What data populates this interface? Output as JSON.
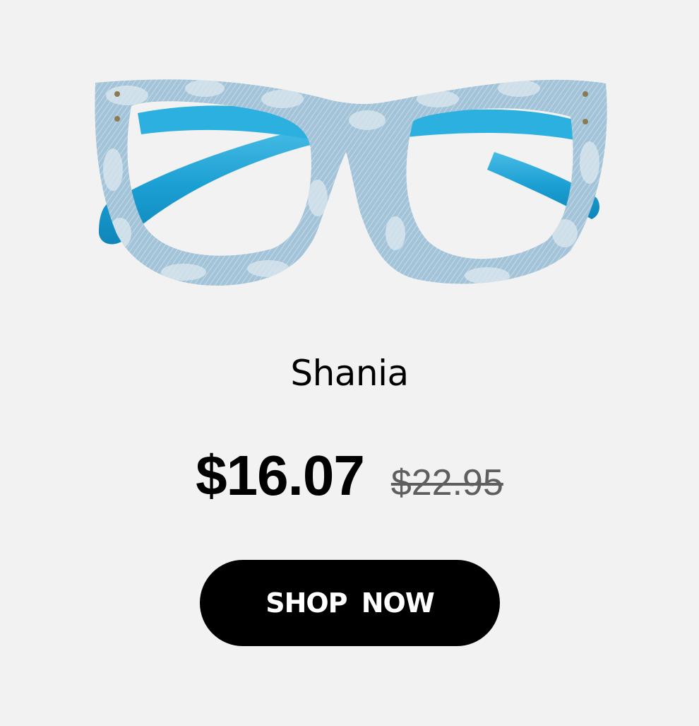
{
  "product": {
    "image_icon": "eyeglasses-icon",
    "name": "Shania",
    "price_current": "$16.07",
    "price_original": "$22.95"
  },
  "cta": {
    "label": "SHOP NOW"
  },
  "colors": {
    "background": "#f2f2f2",
    "frame_denim": "#a9c8dc",
    "temple_blue": "#1fa3d6",
    "button": "#000000",
    "button_text": "#ffffff",
    "original_price": "#5f5f5f"
  }
}
